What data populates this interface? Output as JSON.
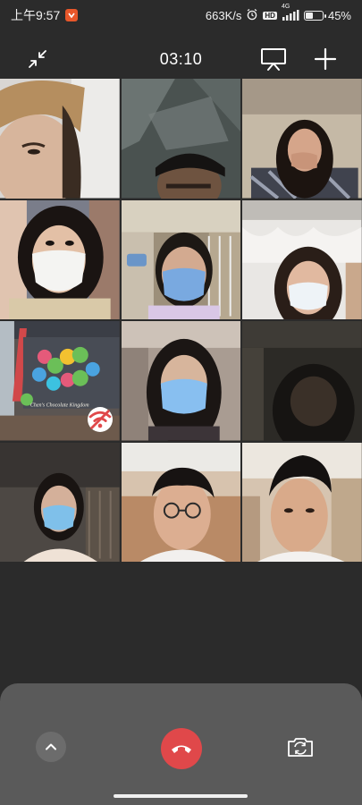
{
  "status_bar": {
    "time": "上午9:57",
    "network_speed": "663K/s",
    "network_type": "4G",
    "hd_label": "HD",
    "battery_percent": "45%",
    "battery_level": 0.45,
    "app_badge_color": "#e8572a"
  },
  "header": {
    "call_timer": "03:10",
    "icons": [
      "minimize-icon",
      "screen-share-icon",
      "add-participant-icon"
    ]
  },
  "participants": [
    {
      "id": 1,
      "scene": "face-closeup"
    },
    {
      "id": 2,
      "scene": "dark-room"
    },
    {
      "id": 3,
      "scene": "hand-on-face"
    },
    {
      "id": 4,
      "scene": "white-mask"
    },
    {
      "id": 5,
      "scene": "blue-mask-shelves"
    },
    {
      "id": 6,
      "scene": "blue-mask-curtain"
    },
    {
      "id": 7,
      "scene": "signboard",
      "network_weak": true
    },
    {
      "id": 8,
      "scene": "blue-mask-long-hair"
    },
    {
      "id": 9,
      "scene": "dark-silhouette"
    },
    {
      "id": 10,
      "scene": "blue-mask-dim"
    },
    {
      "id": 11,
      "scene": "glasses-curly"
    },
    {
      "id": 12,
      "scene": "boy-room"
    }
  ],
  "signboard_text": "Chen's Chocolate Kingdom",
  "controls": {
    "icons": [
      "chevron-up-icon",
      "hang-up-icon",
      "camera-switch-icon"
    ],
    "hangup_color": "#e0484a"
  }
}
